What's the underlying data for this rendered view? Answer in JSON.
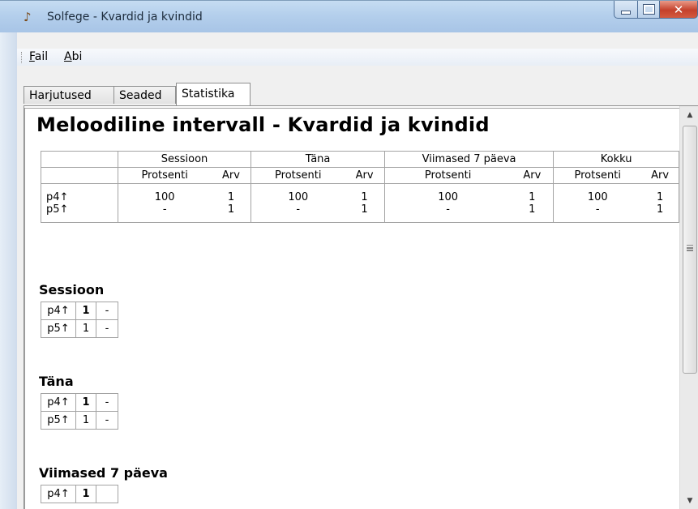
{
  "window": {
    "title": "Solfege - Kvardid ja kvindid",
    "close_glyph": "✕",
    "app_icon": "solfege-app-icon"
  },
  "menu": {
    "items": [
      "Fail",
      "Abi"
    ]
  },
  "tabs": [
    {
      "label": "Harjutused",
      "active": false
    },
    {
      "label": "Seaded",
      "active": false
    },
    {
      "label": "Statistika",
      "active": true
    }
  ],
  "page": {
    "title": "Meloodiline intervall - Kvardid ja kvindid"
  },
  "summary_table": {
    "groups": [
      "Sessioon",
      "Täna",
      "Viimased 7 päeva",
      "Kokku"
    ],
    "subheaders": [
      "Protsenti",
      "Arv"
    ],
    "rows": [
      {
        "label": "p4↑",
        "cells": [
          "100",
          "1",
          "100",
          "1",
          "100",
          "1",
          "100",
          "1"
        ]
      },
      {
        "label": "p5↑",
        "cells": [
          "-",
          "1",
          "-",
          "1",
          "-",
          "1",
          "-",
          "1"
        ]
      }
    ]
  },
  "sections": [
    {
      "title": "Sessioon",
      "rows": [
        {
          "label": "p4↑",
          "value": "1",
          "bold": true,
          "extra": "-"
        },
        {
          "label": "p5↑",
          "value": "1",
          "bold": false,
          "extra": "-"
        }
      ]
    },
    {
      "title": "Täna",
      "rows": [
        {
          "label": "p4↑",
          "value": "1",
          "bold": true,
          "extra": "-"
        },
        {
          "label": "p5↑",
          "value": "1",
          "bold": false,
          "extra": "-"
        }
      ]
    },
    {
      "title": "Viimased 7 päeva",
      "rows": [
        {
          "label": "p4↑",
          "value": "1",
          "bold": true,
          "extra": "-"
        }
      ]
    }
  ],
  "scrollbar": {
    "up_glyph": "▲",
    "down_glyph": "▼"
  }
}
